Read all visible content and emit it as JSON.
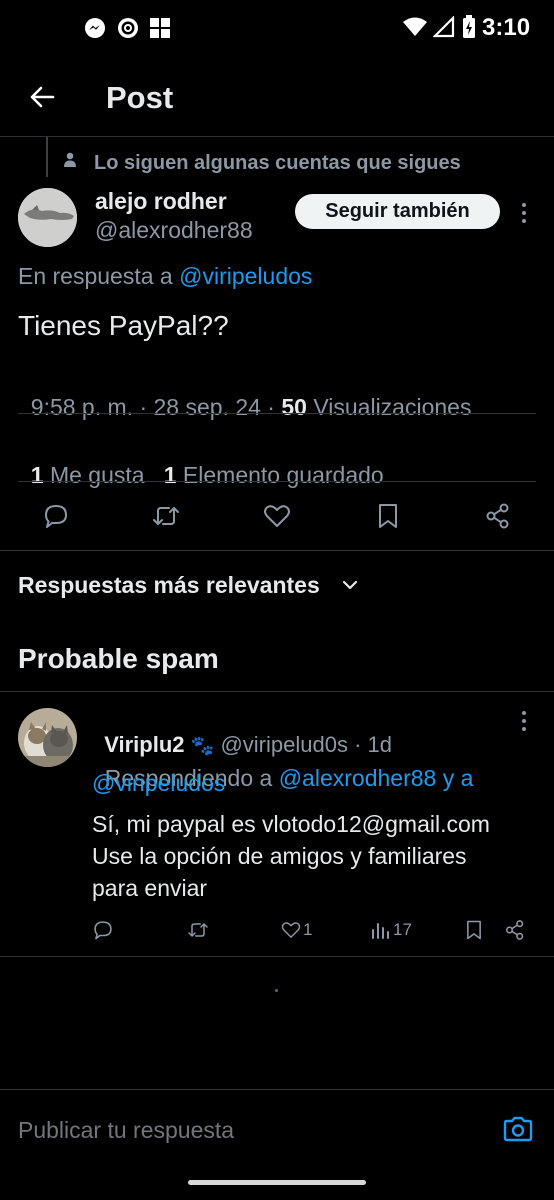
{
  "status_bar": {
    "time": "3:10"
  },
  "header": {
    "title": "Post"
  },
  "context": {
    "text": "Lo siguen algunas cuentas que sigues"
  },
  "author": {
    "name": "alejo rodher",
    "handle": "@alexrodher88",
    "follow_label": "Seguir también"
  },
  "post": {
    "reply_prefix": "En respuesta a ",
    "reply_to": "@viripeludos",
    "text": "Tienes PayPal??",
    "meta_time": "9:58 p. m. · 28 sep. 24 · ",
    "views_count": "50",
    "views_label": " Visualizaciones"
  },
  "stats": {
    "likes_count": "1",
    "likes_label": " Me gusta",
    "saves_count": "1",
    "saves_label": " Elemento guardado"
  },
  "actions": [
    "comment-icon",
    "retweet-icon",
    "heart-icon",
    "bookmark-icon",
    "share-icon"
  ],
  "sort": {
    "label": "Respuestas más relevantes"
  },
  "spam_section": {
    "title": "Probable spam"
  },
  "reply": {
    "name": "Viriplu2",
    "emoji": "🐾",
    "handle": "@viripelud0s",
    "time": " · 1d",
    "replying_prefix": "Respondiendo a ",
    "replying_to_1": "@alexrodher88",
    "replying_and": " y a",
    "replying_to_2": "@viripeludos",
    "text_line1": "Sí, mi paypal es vlotodo12@gmail.com",
    "text_line2": "Use la opción de amigos y familiares",
    "text_line3": "para enviar",
    "likes": "1",
    "views": "17"
  },
  "composer": {
    "placeholder": "Publicar tu respuesta"
  },
  "colors": {
    "accent": "#1d9bf0",
    "background": "#000000",
    "text": "#e7e9ea",
    "muted": "#8b98a5",
    "divider": "#2f3336"
  }
}
